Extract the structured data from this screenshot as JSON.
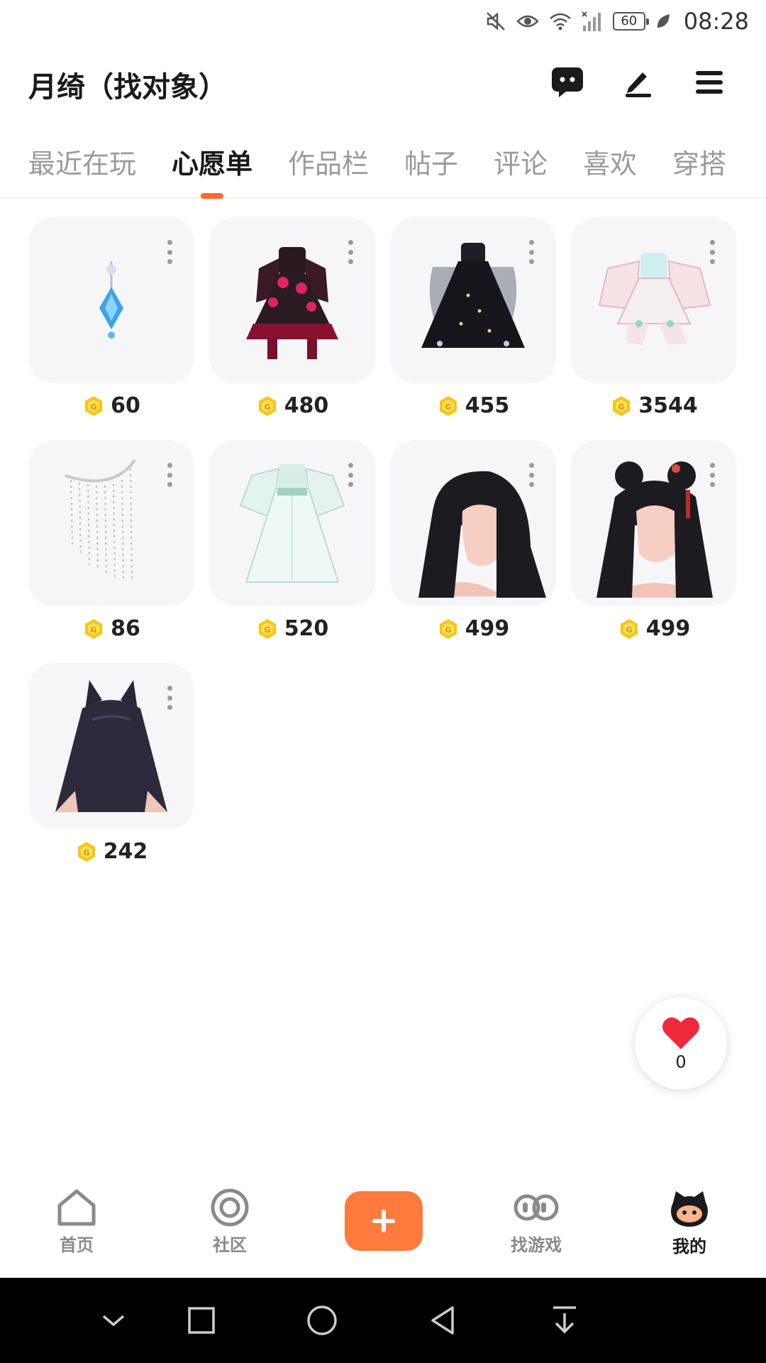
{
  "status_bar": {
    "battery": "60",
    "time": "08:28",
    "icons": [
      "mute-icon",
      "eye-icon",
      "wifi-icon",
      "signal-icon",
      "battery-icon",
      "leaf-icon"
    ]
  },
  "header": {
    "title": "月绮（找对象）",
    "icons": [
      "chat-icon",
      "edit-icon",
      "menu-icon"
    ]
  },
  "tabs": [
    {
      "label": "最近在玩",
      "active": false
    },
    {
      "label": "心愿单",
      "active": true
    },
    {
      "label": "作品栏",
      "active": false
    },
    {
      "label": "帖子",
      "active": false
    },
    {
      "label": "评论",
      "active": false
    },
    {
      "label": "喜欢",
      "active": false
    },
    {
      "label": "穿搭",
      "active": false
    }
  ],
  "wishlist": [
    {
      "item": "pendant",
      "price": "60"
    },
    {
      "item": "gothic-dress",
      "price": "480"
    },
    {
      "item": "black-gown",
      "price": "455"
    },
    {
      "item": "pastel-dress",
      "price": "3544"
    },
    {
      "item": "bead-veil",
      "price": "86"
    },
    {
      "item": "hanfu-dress",
      "price": "520"
    },
    {
      "item": "long-hair",
      "price": "499"
    },
    {
      "item": "twin-bun-hair",
      "price": "499"
    },
    {
      "item": "cat-ear-hair",
      "price": "242"
    }
  ],
  "like_button": {
    "count": "0"
  },
  "bottom_nav": [
    {
      "label": "首页",
      "icon": "home-icon",
      "active": false
    },
    {
      "label": "社区",
      "icon": "community-icon",
      "active": false
    },
    {
      "label": "",
      "icon": "plus-icon",
      "active": false
    },
    {
      "label": "找游戏",
      "icon": "find-game-icon",
      "active": false
    },
    {
      "label": "我的",
      "icon": "profile-icon",
      "active": true
    }
  ],
  "colors": {
    "accent": "#ff6a2c",
    "coin": "#f5c518",
    "card_bg": "#f6f6f9"
  }
}
